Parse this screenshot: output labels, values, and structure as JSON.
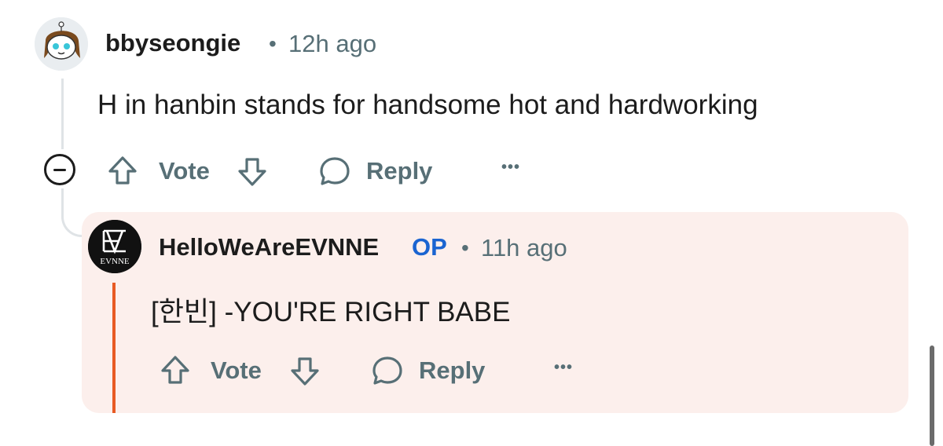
{
  "comment": {
    "username": "bbyseongie",
    "separator": "•",
    "time": "12h ago",
    "body": "H in hanbin stands for handsome hot and hardworking",
    "actions": {
      "vote_label": "Vote",
      "reply_label": "Reply",
      "more_label": "•••"
    }
  },
  "reply": {
    "username": "HelloWeAreEVNNE",
    "op_badge": "OP",
    "separator": "•",
    "time": "11h ago",
    "body": "[한빈] -YOU'RE RIGHT BABE",
    "avatar_text": "EVNNE",
    "actions": {
      "vote_label": "Vote",
      "reply_label": "Reply",
      "more_label": "•••"
    }
  },
  "colors": {
    "accent_op": "#1a64d1",
    "highlight": "#e85a24",
    "reply_bg": "#fcefec",
    "meta_gray": "#576f76"
  }
}
